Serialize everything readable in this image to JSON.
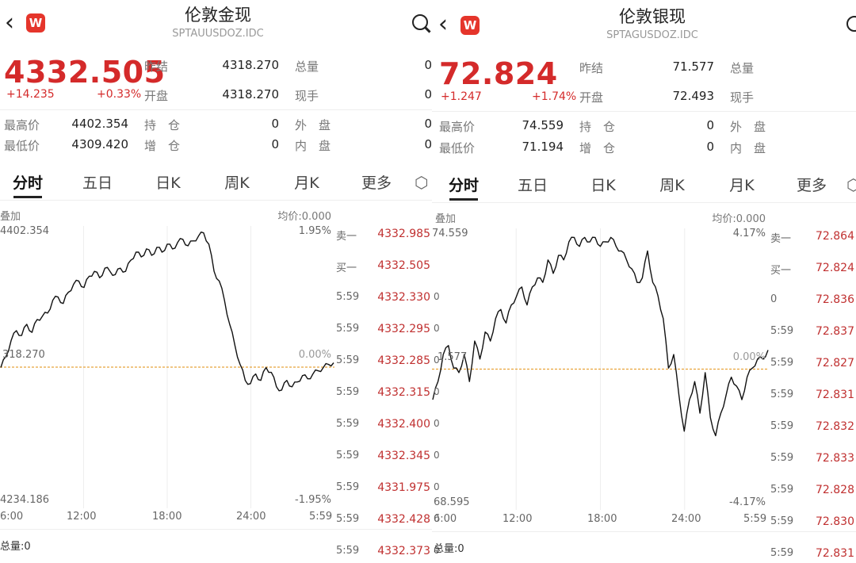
{
  "left": {
    "title": "伦敦金现",
    "code": "SPTAUUSDOZ.IDC",
    "logo": "W",
    "price": "4332.505",
    "change": "+14.235",
    "change_pct": "+0.33%",
    "stats": {
      "prev_close_label": "昨结",
      "prev_close": "4318.270",
      "open_label": "开盘",
      "open": "4318.270",
      "volume_label": "总量",
      "volume": "0",
      "current_hand_label": "现手",
      "current_hand": "0",
      "high_label": "最高价",
      "high": "4402.354",
      "low_label": "最低价",
      "low": "4309.420",
      "hold_label": "持　仓",
      "hold": "0",
      "add_label": "增　仓",
      "add": "0",
      "outer_label": "外　盘",
      "outer": "0",
      "inner_label": "内　盘",
      "inner": "0"
    },
    "tabs": [
      "分时",
      "五日",
      "日K",
      "周K",
      "月K",
      "更多"
    ],
    "chart_header": {
      "overlay": "叠加",
      "avg_price": "均价:0.000"
    },
    "chart_data": {
      "type": "line",
      "y_max_label": "4402.354",
      "y_min_label": "4234.186",
      "prev_label": "318.270",
      "pct_top": "1.95%",
      "pct_mid": "0.00%",
      "pct_bottom": "-1.95%",
      "x_labels": [
        "6:00",
        "12:00",
        "18:00",
        "24:00",
        "5:59"
      ],
      "y_range": [
        4234.186,
        4402.354
      ],
      "prev_close": 4318.27,
      "points": [
        4318.0,
        4325.0,
        4335.0,
        4341.0,
        4338.0,
        4345.0,
        4340.0,
        4348.0,
        4350.0,
        4352.0,
        4360.0,
        4362.0,
        4358.0,
        4365.0,
        4370.0,
        4372.0,
        4368.0,
        4375.0,
        4378.0,
        4374.0,
        4380.0,
        4378.0,
        4376.0,
        4380.0,
        4378.0,
        4385.0,
        4390.0,
        4387.0,
        4392.0,
        4388.0,
        4393.0,
        4390.0,
        4395.0,
        4392.0,
        4396.0,
        4398.0,
        4394.0,
        4397.0,
        4400.0,
        4402.0,
        4395.0,
        4378.0,
        4372.0,
        4360.0,
        4345.0,
        4332.0,
        4320.0,
        4310.0,
        4308.0,
        4314.0,
        4310.0,
        4318.0,
        4315.0,
        4306.0,
        4304.0,
        4310.0,
        4306.0,
        4309.0,
        4313.0,
        4311.0,
        4314.0,
        4316.0,
        4318.0,
        4320.0,
        4321.0
      ]
    },
    "orderbook": [
      {
        "label": "卖一",
        "value": "4332.985"
      },
      {
        "label": "买一",
        "value": "4332.505"
      },
      {
        "label": "5:59",
        "value": "4332.330"
      },
      {
        "label": "5:59",
        "value": "4332.295"
      },
      {
        "label": "5:59",
        "value": "4332.285"
      },
      {
        "label": "5:59",
        "value": "4332.315"
      },
      {
        "label": "5:59",
        "value": "4332.400"
      },
      {
        "label": "5:59",
        "value": "4332.345"
      },
      {
        "label": "5:59",
        "value": "4331.975"
      },
      {
        "label": "5:59",
        "value": "4332.428"
      },
      {
        "label": "5:59",
        "value": "4332.373"
      }
    ],
    "footer": "总量:0"
  },
  "right": {
    "title": "伦敦银现",
    "code": "SPTAGUSDOZ.IDC",
    "logo": "W",
    "price": "72.824",
    "change": "+1.247",
    "change_pct": "+1.74%",
    "stats": {
      "prev_close_label": "昨结",
      "prev_close": "71.577",
      "open_label": "开盘",
      "open": "72.493",
      "volume_label": "总量",
      "volume": "",
      "current_hand_label": "现手",
      "current_hand": "",
      "high_label": "最高价",
      "high": "74.559",
      "low_label": "最低价",
      "low": "71.194",
      "hold_label": "持　仓",
      "hold": "0",
      "add_label": "增　仓",
      "add": "0",
      "outer_label": "外　盘",
      "outer": "",
      "inner_label": "内　盘",
      "inner": ""
    },
    "tabs": [
      "分时",
      "五日",
      "日K",
      "周K",
      "月K",
      "更多"
    ],
    "chart_header": {
      "overlay": "叠加",
      "avg_price": "均价:0.000"
    },
    "chart_data": {
      "type": "line",
      "y_max_label": "74.559",
      "y_min_label": "68.595",
      "prev_label": "1.577",
      "pct_top": "4.17%",
      "pct_mid": "0.00%",
      "pct_bottom": "-4.17%",
      "x_labels": [
        "6:00",
        "12:00",
        "18:00",
        "24:00",
        "5:59"
      ],
      "y_range": [
        68.595,
        74.559
      ],
      "prev_close": 71.577,
      "left_ticks": [
        "0",
        "0",
        "0",
        "0",
        "0",
        "0",
        "0",
        "0",
        "0"
      ],
      "points": [
        70.9,
        71.3,
        71.9,
        72.1,
        71.6,
        71.5,
        71.9,
        71.3,
        72.2,
        71.8,
        72.4,
        72.2,
        72.7,
        72.9,
        72.6,
        73.0,
        73.2,
        73.4,
        73.0,
        73.4,
        73.6,
        73.5,
        74.0,
        73.7,
        74.1,
        74.0,
        74.4,
        74.5,
        74.3,
        74.5,
        74.4,
        74.5,
        74.3,
        74.4,
        74.5,
        74.3,
        74.2,
        74.0,
        73.8,
        73.5,
        73.6,
        74.2,
        73.5,
        73.2,
        72.7,
        71.6,
        71.9,
        71.0,
        70.2,
        70.9,
        71.3,
        70.6,
        71.5,
        70.5,
        70.1,
        70.6,
        71.0,
        71.4,
        71.2,
        70.9,
        71.4,
        71.6,
        71.8,
        71.8,
        72.0
      ]
    },
    "orderbook": [
      {
        "label": "卖一",
        "value": "72.864"
      },
      {
        "label": "买一",
        "value": "72.824"
      },
      {
        "label": "0",
        "value": "72.836"
      },
      {
        "label": "5:59",
        "value": "72.837"
      },
      {
        "label": "5:59",
        "value": "72.827"
      },
      {
        "label": "5:59",
        "value": "72.831"
      },
      {
        "label": "5:59",
        "value": "72.832"
      },
      {
        "label": "5:59",
        "value": "72.833"
      },
      {
        "label": "5:59",
        "value": "72.828"
      },
      {
        "label": "5:59",
        "value": "72.830"
      },
      {
        "label": "5:59",
        "value": "72.831"
      }
    ],
    "footer": "总量:0"
  },
  "colors": {
    "up": "#d42a2a",
    "down": "#1a8a3a",
    "prev_line": "#e8a33a",
    "line": "#111111",
    "brand": "#e5352b"
  },
  "icons": {
    "back": "chevron-left-icon",
    "search": "search-icon",
    "settings": "hexagon-settings-icon",
    "logo": "w-logo-icon"
  }
}
